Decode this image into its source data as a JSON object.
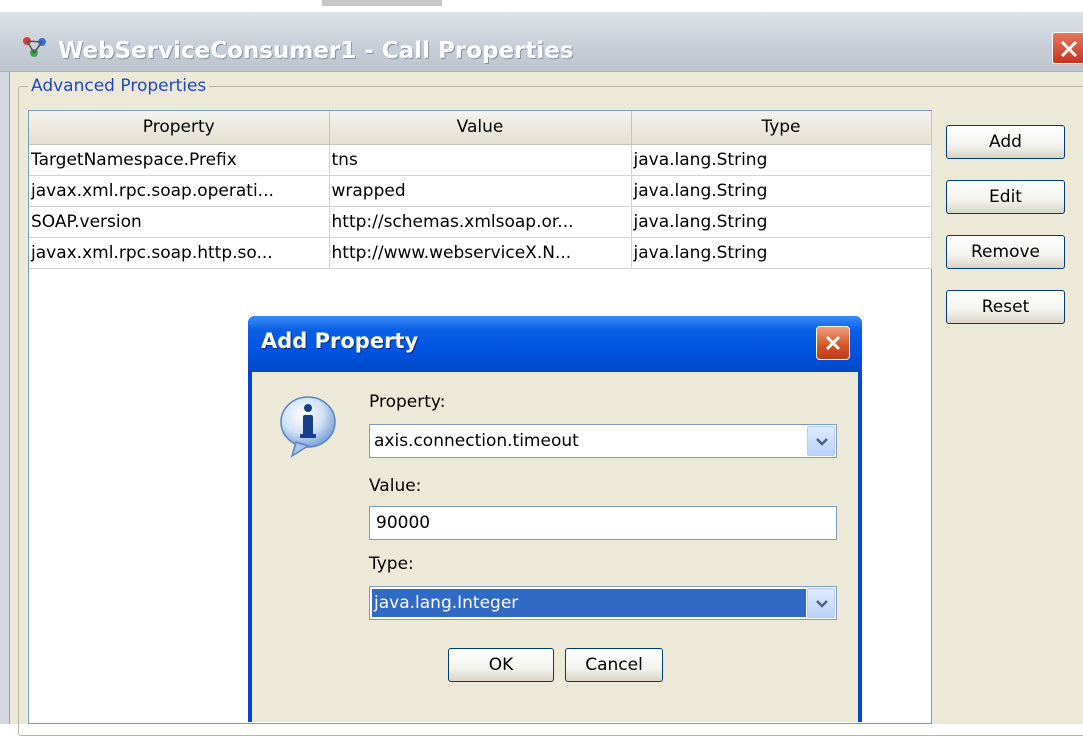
{
  "window": {
    "title": "WebServiceConsumer1  - Call Properties"
  },
  "group": {
    "label": "Advanced Properties"
  },
  "table": {
    "columns": [
      "Property",
      "Value",
      "Type"
    ],
    "rows": [
      [
        "TargetNamespace.Prefix",
        "tns",
        "java.lang.String"
      ],
      [
        "javax.xml.rpc.soap.operati...",
        "wrapped",
        "java.lang.String"
      ],
      [
        "SOAP.version",
        "http://schemas.xmlsoap.or...",
        "java.lang.String"
      ],
      [
        "javax.xml.rpc.soap.http.so...",
        "http://www.webserviceX.N...",
        "java.lang.String"
      ]
    ]
  },
  "side_buttons": {
    "add": "Add",
    "edit": "Edit",
    "remove": "Remove",
    "reset": "Reset"
  },
  "dialog": {
    "title": "Add Property",
    "property_label": "Property:",
    "property_value": "axis.connection.timeout",
    "value_label": "Value:",
    "value_value": "90000",
    "type_label": "Type:",
    "type_value": "java.lang.Integer",
    "ok": "OK",
    "cancel": "Cancel"
  },
  "colors": {
    "xp_title_blue": "#0054e3",
    "selection_blue": "#316ac5",
    "group_label_blue": "#1e48c3",
    "close_red": "#d4512a"
  },
  "icons": {
    "window_icon": "webservice-icon",
    "dialog_icon": "information-icon",
    "close": "close-icon",
    "dropdown": "chevron-down-icon"
  }
}
